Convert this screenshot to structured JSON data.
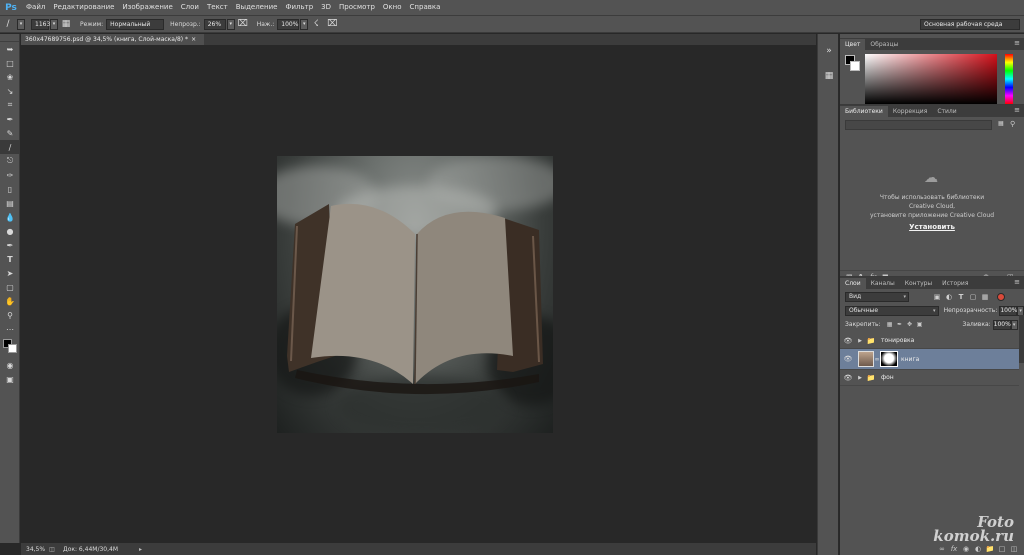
{
  "app": {
    "logo": "Ps"
  },
  "menu": [
    "Файл",
    "Редактирование",
    "Изображение",
    "Слои",
    "Текст",
    "Выделение",
    "Фильтр",
    "3D",
    "Просмотр",
    "Окно",
    "Справка"
  ],
  "options": {
    "brush_size": "1163",
    "mode_label": "Режим:",
    "mode_value": "Нормальный",
    "opacity_label": "Непрозр.:",
    "opacity_value": "26%",
    "flow_label": "Наж.:",
    "flow_value": "100%",
    "workspace": "Основная рабочая среда"
  },
  "document": {
    "tab_title": "360x47689756.psd @ 34,5% (книга, Слой-маска/8) *",
    "close_glyph": "×"
  },
  "status": {
    "zoom": "34,5%",
    "doc_info": "Док: 6,44M/30,4M"
  },
  "color_panel": {
    "tabs": [
      "Цвет",
      "Образцы"
    ]
  },
  "libraries": {
    "tabs": [
      "Библиотеки",
      "Коррекция",
      "Стили"
    ],
    "message_line1": "Чтобы использовать библиотеки",
    "message_line2": "Creative Cloud,",
    "message_line3": "установите приложение Creative Cloud",
    "install_link": "Установить"
  },
  "layers": {
    "tabs": [
      "Слои",
      "Каналы",
      "Контуры",
      "История"
    ],
    "filter_kind": "Вид",
    "blend_mode": "Обычные",
    "opacity_label": "Непрозрачность:",
    "opacity_value": "100%",
    "lock_label": "Закрепить:",
    "fill_label": "Заливка:",
    "fill_value": "100%",
    "items": [
      {
        "name": "тонировка",
        "type": "group"
      },
      {
        "name": "книга",
        "type": "layer-with-mask",
        "selected": true
      },
      {
        "name": "фон",
        "type": "group"
      }
    ]
  },
  "watermark": {
    "line1": "Foto",
    "line2": "komok.ru"
  }
}
